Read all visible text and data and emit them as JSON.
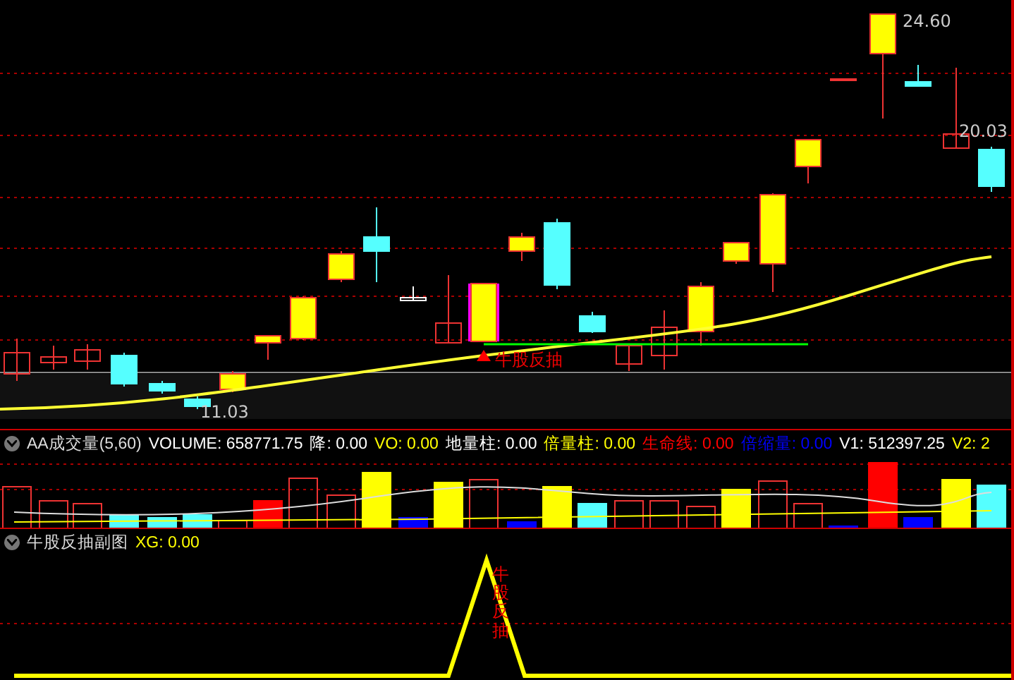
{
  "main_chart": {
    "price_labels": [
      {
        "text": "24.60",
        "kind": "high"
      },
      {
        "text": "20.03",
        "kind": "last"
      },
      {
        "text": "11.03",
        "kind": "low"
      }
    ],
    "signal_label": "牛股反抽"
  },
  "volume_panel": {
    "title": "AA成交量(5,60)",
    "readouts": [
      {
        "label": "VOLUME:",
        "value": "658771.75",
        "color": "#ffffff"
      },
      {
        "label": "降:",
        "value": "0.00",
        "color": "#ffffff"
      },
      {
        "label": "VO:",
        "value": "0.00",
        "color": "#ffff00"
      },
      {
        "label": "地量柱:",
        "value": "0.00",
        "color": "#ffffff"
      },
      {
        "label": "倍量柱:",
        "value": "0.00",
        "color": "#ffff00"
      },
      {
        "label": "生命线:",
        "value": "0.00",
        "color": "#ff0000"
      },
      {
        "label": "倍缩量:",
        "value": "0.00",
        "color": "#0000ff"
      },
      {
        "label": "V1:",
        "value": "512397.25",
        "color": "#ffffff"
      },
      {
        "label": "V2:",
        "value": "2",
        "color": "#ffff00"
      }
    ]
  },
  "signal_panel": {
    "title": "牛股反抽副图",
    "readouts": [
      {
        "label": "XG:",
        "value": "0.00",
        "color": "#ffff00"
      }
    ],
    "peak_label": "牛股反抽"
  }
}
